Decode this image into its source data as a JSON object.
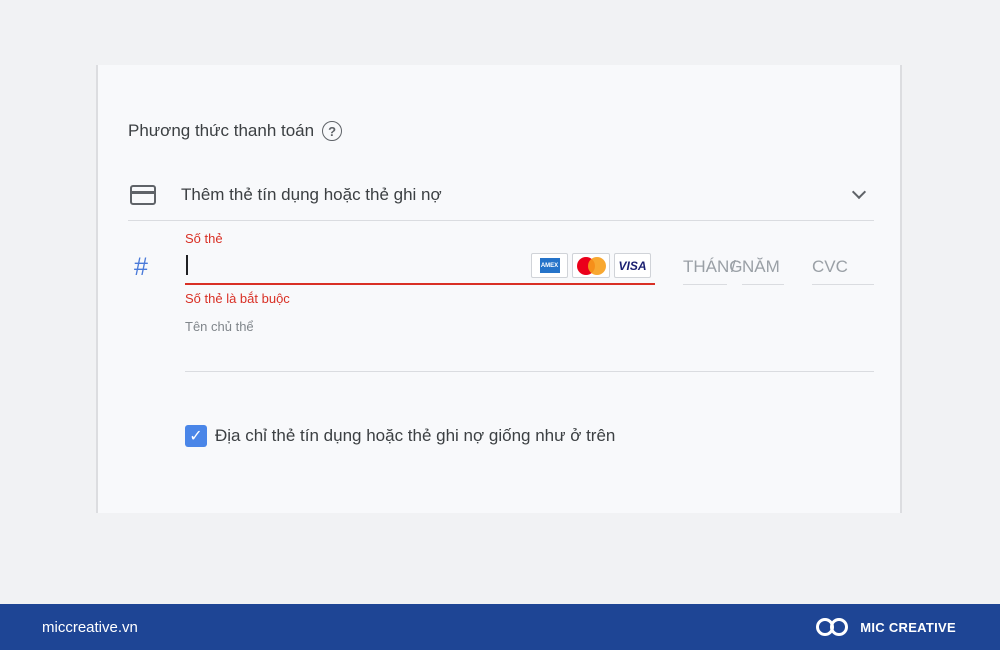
{
  "payment": {
    "section_title": "Phương thức thanh toán",
    "method_label": "Thêm thẻ tín dụng hoặc thẻ ghi nợ",
    "card_number_label": "Số thẻ",
    "card_number_value": "",
    "card_number_error": "Số thẻ là bắt buộc",
    "card_brands": [
      "AMEX",
      "MasterCard",
      "VISA"
    ],
    "month_placeholder": "THÁNG",
    "slash": "/",
    "year_placeholder": "NĂM",
    "cvc_placeholder": "CVC",
    "holder_label": "Tên chủ thể",
    "same_address_label": "Địa chỉ thẻ tín dụng hoặc thẻ ghi nợ giống như ở trên",
    "same_address_checked": true,
    "hash_symbol": "#",
    "help_symbol": "?"
  },
  "footer": {
    "site": "miccreative.vn",
    "brand": "MIC CREATIVE"
  },
  "colors": {
    "error": "#d93025",
    "accent": "#4a86e8",
    "footer_bg": "#1e4595"
  },
  "icons": [
    "help-circle-icon",
    "credit-card-icon",
    "chevron-down-icon",
    "hash-icon",
    "checkbox-checked-icon",
    "mic-creative-logo-icon"
  ]
}
